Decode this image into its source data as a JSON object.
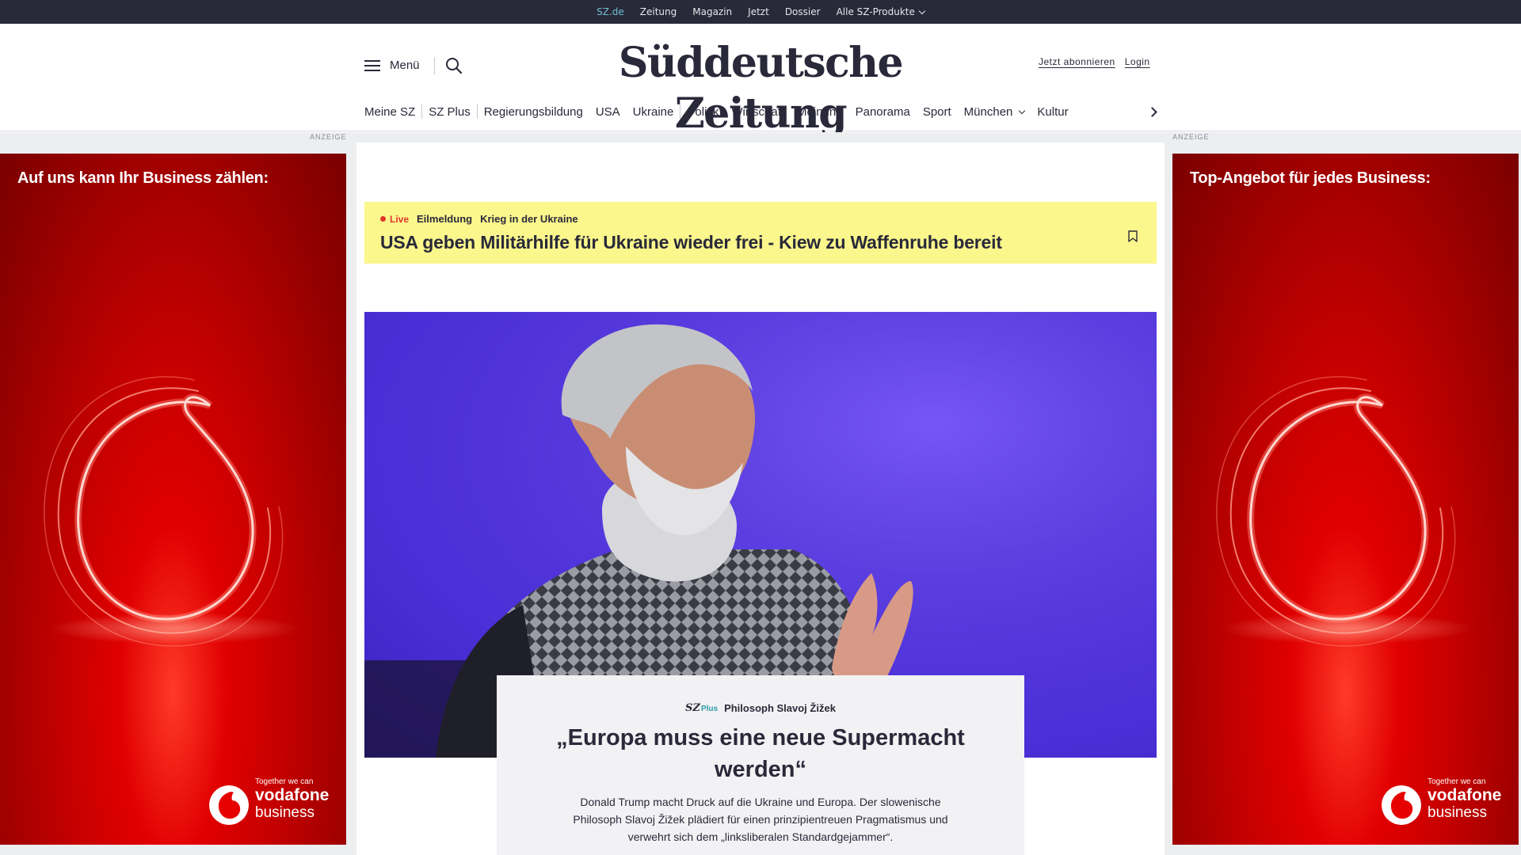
{
  "topbar": {
    "links": [
      {
        "label": "SZ.de"
      },
      {
        "label": "Zeitung"
      },
      {
        "label": "Magazin"
      },
      {
        "label": "Jetzt"
      },
      {
        "label": "Dossier"
      },
      {
        "label": "Alle SZ-Produkte"
      }
    ]
  },
  "header": {
    "menu_label": "Menü",
    "logo": "Süddeutsche Zeitung",
    "subscribe": "Jetzt abonnieren",
    "login": "Login"
  },
  "nav": {
    "items": [
      {
        "label": "Meine SZ"
      },
      {
        "label": "SZ Plus"
      },
      {
        "label": "Regierungsbildung"
      },
      {
        "label": "USA"
      },
      {
        "label": "Ukraine"
      },
      {
        "label": "Politik"
      },
      {
        "label": "Wirtschaft"
      },
      {
        "label": "Meinung"
      },
      {
        "label": "Panorama"
      },
      {
        "label": "Sport"
      },
      {
        "label": "München"
      },
      {
        "label": "Kultur"
      }
    ]
  },
  "ads": {
    "label": "ANZEIGE",
    "left": {
      "headline": "Auf uns kann Ihr Business zählen:",
      "tagline": "Together we can",
      "brand": "vodafone",
      "sub": "business"
    },
    "right": {
      "headline": "Top-Angebot für jedes Business:",
      "tagline": "Together we can",
      "brand": "vodafone",
      "sub": "business"
    }
  },
  "breaking": {
    "live": "Live",
    "tag1": "Eilmeldung",
    "tag2": "Krieg in der Ukraine",
    "headline": "USA geben Militärhilfe für Ukraine wieder frei - Kiew zu Waffenruhe bereit"
  },
  "teaser": {
    "plus_sz": "SZ",
    "plus_word": "Plus",
    "kicker": "Philosoph Slavoj Žižek",
    "title": "„Europa muss eine neue Supermacht werden“",
    "summary": "Donald Trump macht Druck auf die Ukraine und Europa. Der slowenische Philosoph Slavoj Žižek plädiert für einen prinzipientreuen Pragmatismus und verwehrt sich dem „linksliberalen Standardgejammer“."
  },
  "colors": {
    "topbar_bg": "#29293a",
    "accent_teal": "#6fc1cf",
    "breaking_bg": "#fbf78c",
    "live_red": "#e2342b",
    "ad_red": "#e00000",
    "hero_violet": "#5a3ce6"
  },
  "icons": [
    "menu-icon",
    "search-icon",
    "chevron-down-icon",
    "chevron-right-icon",
    "bookmark-icon",
    "vodafone-speechmark-icon"
  ]
}
